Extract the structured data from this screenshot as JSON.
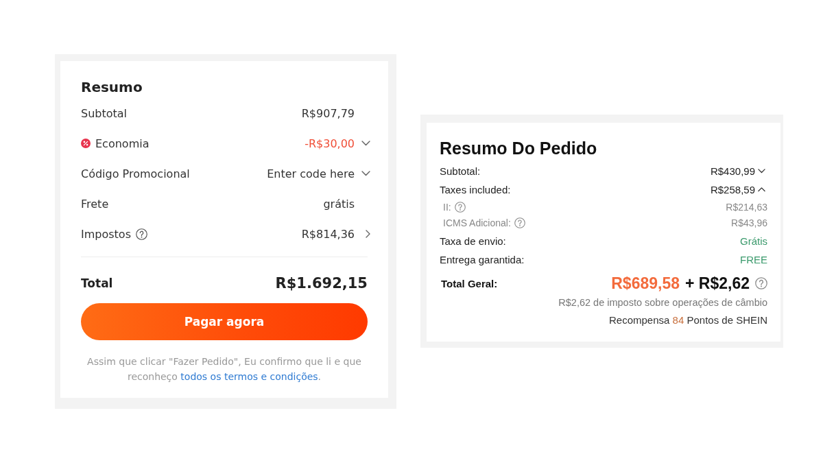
{
  "order_summary": {
    "title": "Resumo",
    "rows": [
      {
        "kind": "plain",
        "label": "Subtotal",
        "value": "R$907,79"
      },
      {
        "kind": "discount",
        "label": "Economia",
        "value": "-R$30,00",
        "expanded": false
      },
      {
        "kind": "promo",
        "label": "Código Promocional",
        "value": "Enter code here",
        "expanded": false
      },
      {
        "kind": "plain",
        "label": "Frete",
        "value": "grátis"
      },
      {
        "kind": "tax",
        "label": "Impostos",
        "value": "R$814,36"
      }
    ],
    "total": {
      "label": "Total",
      "value": "R$1.692,15"
    },
    "pay_button": "Pagar agora",
    "terms": {
      "text": "Assim que clicar \"Fazer Pedido\", Eu confirmo que li e que reconheço",
      "link": "todos os termos e condições",
      "end": "."
    }
  },
  "order_details": {
    "title": "Resumo Do Pedido",
    "rows": [
      {
        "kind": "toggle",
        "label": "Subtotal:",
        "value": "R$430,99",
        "expanded": false
      },
      {
        "kind": "toggle",
        "label": "Taxes included:",
        "value": "R$258,59",
        "expanded": true,
        "children": [
          {
            "label": "II:",
            "value": "R$214,63"
          },
          {
            "label": "ICMS Adicional:",
            "value": "R$43,96"
          }
        ]
      },
      {
        "kind": "free",
        "label": "Taxa de envio:",
        "value": "Grátis"
      },
      {
        "kind": "free",
        "label": "Entrega garantida:",
        "value": "FREE"
      }
    ],
    "total": {
      "label": "Total Geral:",
      "amount": "R$689,58",
      "extra": "+ R$2,62"
    },
    "exchange_tax_note": "R$2,62 de imposto sobre operações de câmbio",
    "reward": {
      "before": "Recompensa",
      "points": "84",
      "after": "Pontos de SHEIN"
    }
  }
}
